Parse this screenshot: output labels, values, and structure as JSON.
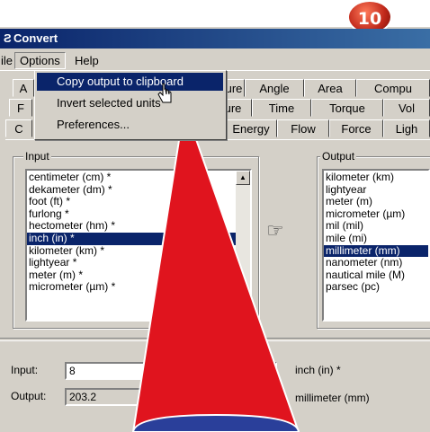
{
  "badge": "10",
  "window": {
    "title": "Convert",
    "icon": "convert-app-icon"
  },
  "menubar": [
    "ile",
    "Options",
    "Help"
  ],
  "options_menu": {
    "items": [
      "Copy output to clipboard",
      "Invert selected units",
      "Preferences..."
    ],
    "highlighted_index": 0
  },
  "tabs_row1": [
    "A",
    "ure",
    "Angle",
    "Area",
    "Compu"
  ],
  "tabs_row2": [
    "F",
    "ure",
    "Time",
    "Torque",
    "Vol"
  ],
  "tabs_row3": [
    "C",
    "Energy",
    "Flow",
    "Force",
    "Ligh"
  ],
  "input_group": {
    "label": "Input",
    "items": [
      "centimeter (cm) *",
      "dekameter (dm) *",
      "foot (ft) *",
      "furlong *",
      "hectometer (hm) *",
      "inch (in) *",
      "kilometer (km) *",
      "lightyear *",
      "meter (m) *",
      "micrometer (µm) *"
    ],
    "selected_index": 5
  },
  "output_group": {
    "label": "Output",
    "items": [
      "kilometer (km)",
      "lightyear",
      "meter (m)",
      "micrometer (µm)",
      "mil (mil)",
      "mile (mi)",
      "millimeter (mm)",
      "nanometer (nm)",
      "nautical mile (M)",
      "parsec (pc)"
    ],
    "selected_index": 6
  },
  "pointer_icon": "hand-pointing-right-icon",
  "bottom": {
    "input_label": "Input:",
    "input_value": "8",
    "input_unit": "inch (in) *",
    "output_label": "Output:",
    "output_value": "203.2",
    "output_unit": "millimeter (mm)"
  },
  "colors": {
    "highlight": "#0a246a",
    "callout_red": "#e0141e",
    "badge_red": "#c0281a",
    "callout_blue": "#2a3f9a"
  }
}
